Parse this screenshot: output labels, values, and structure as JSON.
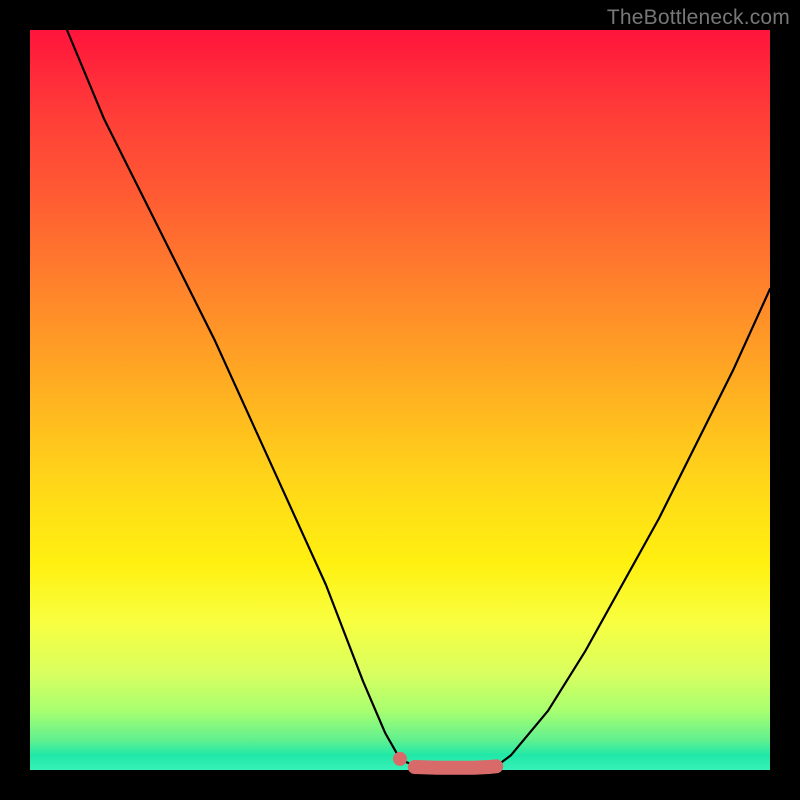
{
  "watermark": "TheBottleneck.com",
  "colors": {
    "background": "#000000",
    "curve_stroke": "#000000",
    "marker_stroke": "#d86a6a",
    "marker_fill": "#d86a6a"
  },
  "chart_data": {
    "type": "line",
    "title": "",
    "xlabel": "",
    "ylabel": "",
    "xlim": [
      0,
      100
    ],
    "ylim": [
      0,
      100
    ],
    "grid": false,
    "legend": false,
    "series": [
      {
        "name": "left-branch",
        "x": [
          5,
          10,
          15,
          20,
          25,
          30,
          35,
          40,
          45,
          48,
          50,
          52
        ],
        "y": [
          100,
          88,
          78,
          68,
          58,
          47,
          36,
          25,
          12,
          5,
          1.5,
          0.5
        ]
      },
      {
        "name": "right-branch",
        "x": [
          63,
          65,
          70,
          75,
          80,
          85,
          90,
          95,
          100
        ],
        "y": [
          0.5,
          2,
          8,
          16,
          25,
          34,
          44,
          54,
          65
        ]
      },
      {
        "name": "flat-minimum-highlight",
        "x": [
          52,
          55,
          58,
          60,
          62,
          63
        ],
        "y": [
          0.4,
          0.3,
          0.3,
          0.3,
          0.4,
          0.5
        ]
      }
    ],
    "markers": [
      {
        "name": "lone-dot",
        "x": 50,
        "y": 1.5
      }
    ],
    "annotations": []
  }
}
